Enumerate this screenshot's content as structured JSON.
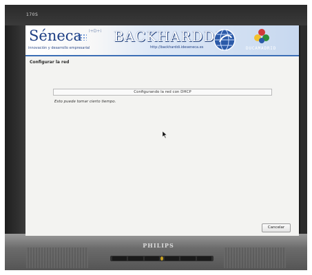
{
  "monitor": {
    "model": "170S",
    "brand": "PHILIPS"
  },
  "banner": {
    "seneca_logo": "Séneca",
    "seneca_idmark": "I+D+i",
    "seneca_tagline": "innovación y desarrollo empresarial",
    "backharddi_logo": "BACKHARDDI",
    "backharddi_url": "http://backharddi.ideseneca.es",
    "educa_label": "DUCAMADRID",
    "accent_color": "#3a6db5"
  },
  "page": {
    "title": "Configurar la red"
  },
  "progress": {
    "label": "Configurando la red con DHCP",
    "hint": "Esto puede tomar cierto tiempo.",
    "value": 0
  },
  "actions": {
    "cancel_label": "Cancelar"
  }
}
